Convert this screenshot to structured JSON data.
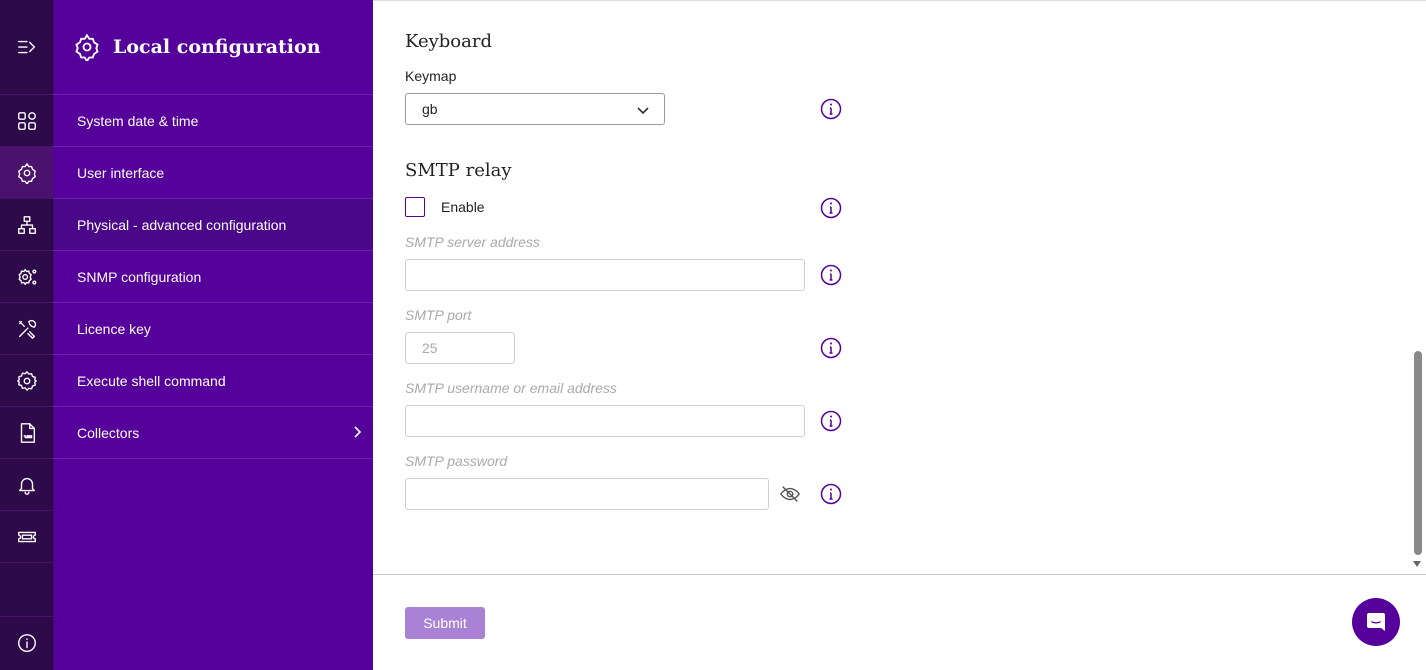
{
  "sidebar": {
    "title": "Local configuration",
    "items": [
      {
        "label": "System date & time"
      },
      {
        "label": "User interface"
      },
      {
        "label": "Physical - advanced configuration"
      },
      {
        "label": "SNMP configuration"
      },
      {
        "label": "Licence key"
      },
      {
        "label": "Execute shell command"
      },
      {
        "label": "Collectors"
      }
    ],
    "active_item": "Physical - advanced configuration"
  },
  "rail": {
    "icons": [
      "collapse-menu-icon",
      "dashboard-icon",
      "settings-network-icon",
      "hierarchy-icon",
      "settings-nodes-icon",
      "tools-icon",
      "gear-icon",
      "log-file-icon",
      "bell-icon",
      "ticket-icon",
      "info-icon"
    ]
  },
  "keyboard": {
    "title": "Keyboard",
    "keymap_label": "Keymap",
    "keymap_value": "gb"
  },
  "smtp": {
    "title": "SMTP relay",
    "enable_label": "Enable",
    "enabled": false,
    "server_label": "SMTP server address",
    "server_value": "",
    "port_label": "SMTP port",
    "port_value": "25",
    "username_label": "SMTP username or email address",
    "username_value": "",
    "password_label": "SMTP password",
    "password_value": ""
  },
  "footer": {
    "submit_label": "Submit"
  },
  "colors": {
    "brand": "#55009b",
    "rail": "#2e0a4a",
    "submit_disabled": "#a982d6"
  }
}
